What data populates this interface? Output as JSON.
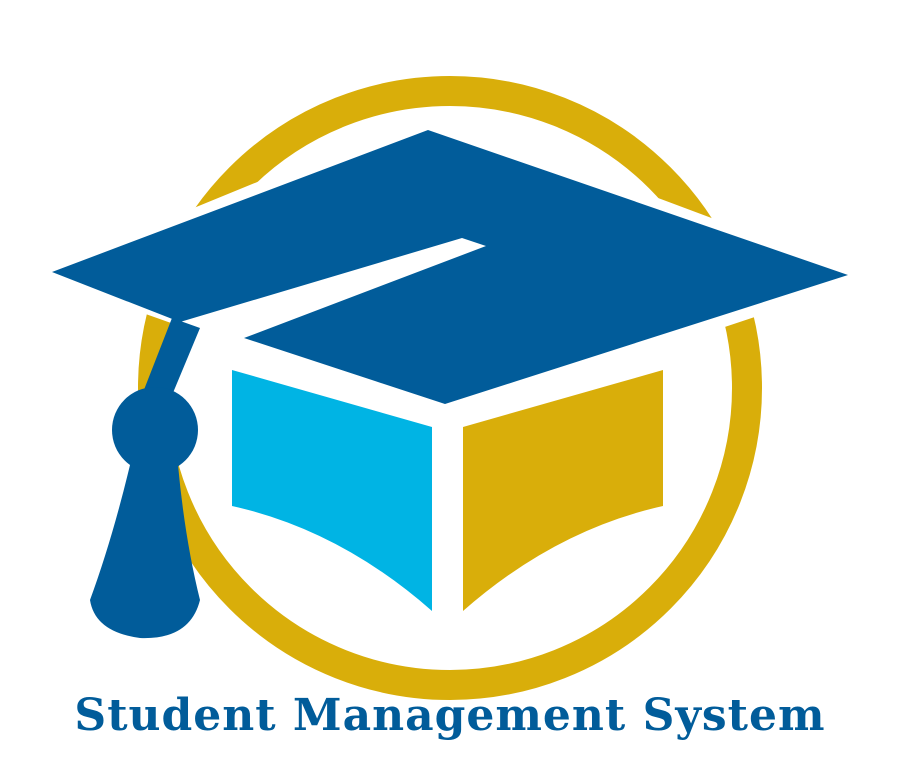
{
  "logo": {
    "title": "Student Management System",
    "icon": "graduation-cap-book-icon"
  },
  "colors": {
    "navy": "#015c9a",
    "gold": "#d9ae0a",
    "cyan": "#00b4e4",
    "background": "#ffffff"
  }
}
